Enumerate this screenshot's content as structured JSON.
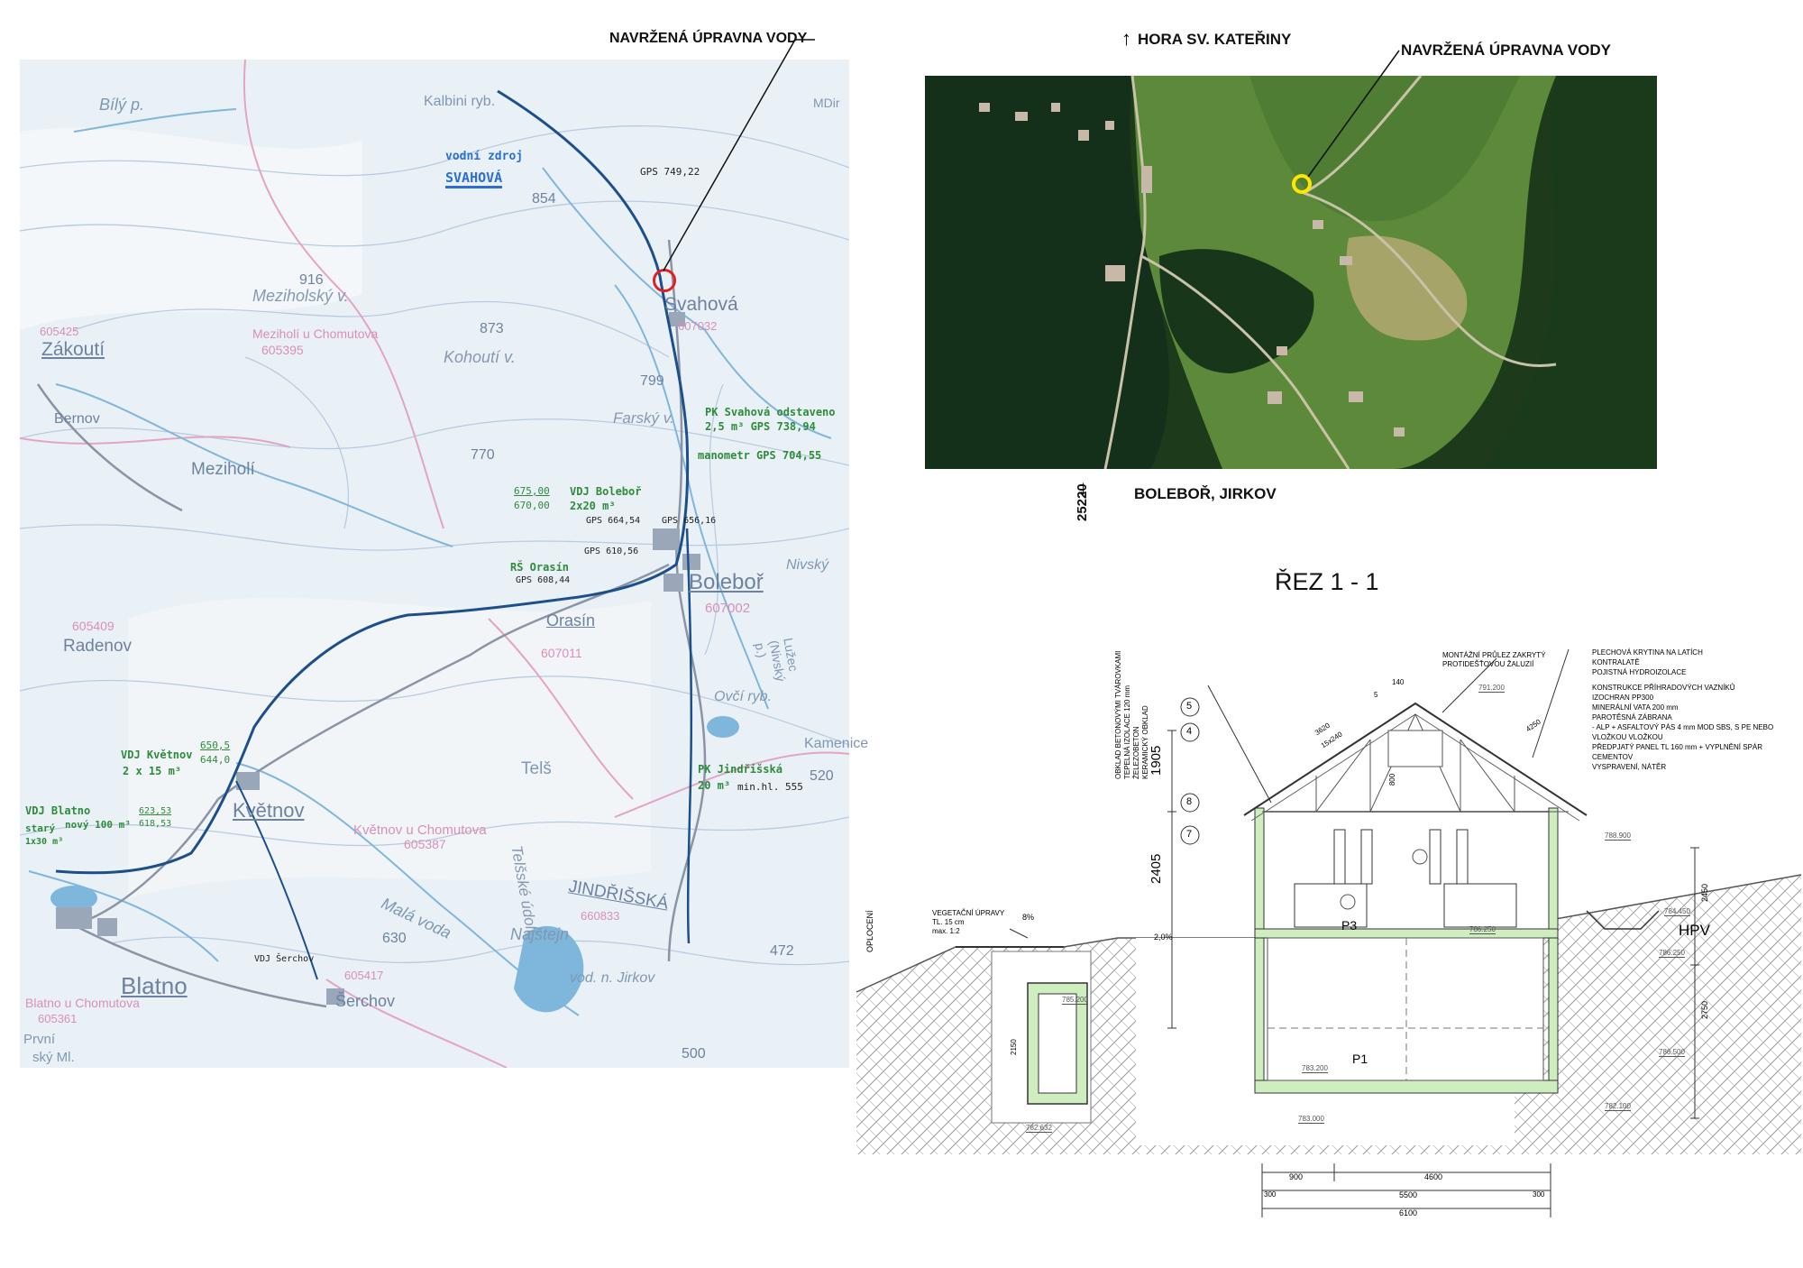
{
  "callouts": {
    "map_proposed_plant": "NAVRŽENÁ ÚPRAVNA VODY",
    "aerial_proposed_plant": "NAVRŽENÁ ÚPRAVNA VODY",
    "direction_north": "HORA SV. KATEŘINY",
    "direction_south": "BOLEBOŘ, JIRKOV",
    "road_number": "25220"
  },
  "section": {
    "title": "ŘEZ 1 - 1",
    "label_oploceni": "OPLOCENÍ",
    "label_hpv": "HPV",
    "label_p3": "P3",
    "label_p1": "P1",
    "notes_left": [
      "OBKLAD BETONOVÝMI TVÁROVKAMI",
      "TEPELNÁ IZOLACE 120 mm",
      "ŽELEZOBETON",
      "KERAMICKÝ OBKLAD"
    ],
    "note_pruvlek": [
      "MONTÁŽNÍ PRŮLEZ ZAKRYTÝ",
      "PROTIDEŠŤOVOU ŽALUZIÍ"
    ],
    "notes_right": [
      "PLECHOVÁ KRYTINA NA LATÍCH",
      "KONTRALATĚ",
      "POJISTNÁ HYDROIZOLACE",
      "",
      "KONSTRUKCE PŘÍHRADOVÝCH VAZNÍKŮ",
      "IZOCHRAN PP300",
      "MINERÁLNÍ VATA 200 mm",
      "PAROTĚSNÁ ZÁBRANA",
      "- ALP + ASFALTOVÝ PÁS 4 mm MOD SBS, S PE NEBO",
      "VLOŽKOU VLOŽKOU",
      "PŘEDPJATÝ PANEL TL 160 mm + VYPLNĚNÍ SPÁR CEMENTOV",
      "VYSPRAVENÍ, NÁTĚR"
    ],
    "note_vegetace": [
      "VEGETAČNÍ ÚPRAVY",
      "TL. 15 cm",
      "max. 1:2"
    ],
    "dims_vertical": [
      "1905",
      "2405",
      "2450",
      "2750",
      "2150"
    ],
    "dims_bottom": [
      "900",
      "4600",
      "5500",
      "6100",
      "300",
      "300"
    ],
    "dims_roof": [
      "4250",
      "3620",
      "15x240",
      "800",
      "140",
      "5"
    ],
    "levels": [
      "791.200",
      "788.900",
      "786.250",
      "786.250",
      "785.200",
      "783.200",
      "782.632",
      "783.000",
      "782.100",
      "786.500",
      "784.450"
    ],
    "slope": "8%",
    "slope2": "2,0%",
    "markers": [
      "5",
      "4",
      "8",
      "7"
    ]
  },
  "map": {
    "place_labels": [
      "Bílý p.",
      "Kalbini ryb.",
      "Svahová",
      "Meziholský v.",
      "Meziholí u Chomutova",
      "Zákoutí",
      "Bernov",
      "Kohoutí v.",
      "Farský v.",
      "Meziholí",
      "Boleboř",
      "Orasín",
      "Radenov",
      "Ovčí ryb.",
      "Kamenice",
      "Telš",
      "Květnov",
      "Květnov u Chomutova",
      "Telšské údolí",
      "JINDŘIŠSKÁ",
      "Malá voda",
      "Najštejn",
      "vod. n. Jirkov",
      "Blatno",
      "Šerchov",
      "Blatno u Chomutova",
      "První",
      "ský Ml.",
      "Nivský",
      "Lužec (Nivský p.)",
      "MDir"
    ],
    "elevations": [
      "916",
      "873",
      "854",
      "799",
      "770",
      "630",
      "520",
      "472",
      "500"
    ],
    "codes": [
      "607032",
      "605395",
      "605425",
      "607002",
      "607011",
      "605409",
      "605387",
      "660833",
      "605417",
      "605361"
    ],
    "annotations": {
      "source_label": "vodní zdroj",
      "source_name": "SVAHOVÁ",
      "gps_source": "GPS 749,22",
      "pk_svahova": "PK Svahová odstaveno",
      "pk_svahova_vol": "2,5 m³  GPS 738,94",
      "manometr": "manometr  GPS 704,55",
      "vdj_bolebor": "VDJ Boleboř",
      "vdj_bolebor_vol": "2x20 m³",
      "vdj_bolebor_lv1": "675,00",
      "vdj_bolebor_lv2": "670,00",
      "gps_bolebor1": "GPS 664,54",
      "gps_bolebor2": "GPS 656,16",
      "gps_bolebor3": "GPS 610,56",
      "rs_orasin": "RŠ Orasín",
      "gps_orasin": "GPS 608,44",
      "pk_jindrisska": "PK Jindřišská",
      "pk_jindrisska_vol": "20 m³",
      "pk_jindrisska_min": "min.hl. 555",
      "vdj_kvetnov": "VDJ Květnov",
      "vdj_kvetnov_vol": "2 x 15 m³",
      "vdj_kvetnov_lv1": "650,5",
      "vdj_kvetnov_lv2": "644,0",
      "vdj_blatno": "VDJ Blatno",
      "vdj_blatno_new": "nový  100 m³",
      "vdj_blatno_lv1": "623,53",
      "vdj_blatno_lv2": "618,53",
      "vdj_blatno_old": "starý",
      "vdj_blatno_old_vol": "1x30 m³",
      "vdj_serchov": "VDJ Šerchov"
    }
  },
  "colors": {
    "map_bg": "#e9f1f7",
    "route": "#1d4f8a",
    "water": "#7fb6dc",
    "annotation": "#2e8b3a",
    "marker_map": "#e02020",
    "marker_aerial": "#ffe600",
    "building_fill": "#cfeec0"
  }
}
